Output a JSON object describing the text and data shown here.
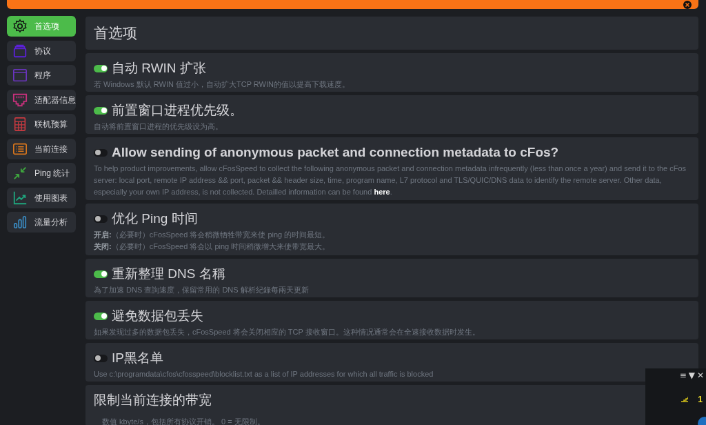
{
  "sidebar": {
    "items": [
      {
        "label": "首选项",
        "color": "#111111",
        "selected": true
      },
      {
        "label": "协议",
        "color": "#5b21d6",
        "selected": false
      },
      {
        "label": "程序",
        "color": "#6b35c0",
        "selected": false
      },
      {
        "label": "适配器信息",
        "color": "#c8307c",
        "selected": false
      },
      {
        "label": "联机预算",
        "color": "#c83a40",
        "selected": false
      },
      {
        "label": "当前连接",
        "color": "#d8761c",
        "selected": false
      },
      {
        "label": "Ping 统计",
        "color": "#3ea63e",
        "selected": false
      },
      {
        "label": "使用图表",
        "color": "#1fa67e",
        "selected": false
      },
      {
        "label": "流量分析",
        "color": "#3a8ec6",
        "selected": false
      }
    ]
  },
  "page_title": "首选项",
  "settings": [
    {
      "kind": "toggle",
      "title": "自动 RWIN 扩张",
      "on": true,
      "description": [
        "若 Windows 默认 RWIN 值过小，自动扩大TCP RWIN的值以提高下载速度。"
      ]
    },
    {
      "kind": "toggle",
      "title": "前置窗口进程优先级。",
      "on": true,
      "description": [
        "自动将前置窗口进程的优先级设为高。"
      ]
    },
    {
      "kind": "toggle",
      "title": "Allow sending of anonymous packet and connection metadata to cFos?",
      "on": false,
      "description": [
        "To help product improvements, allow cFosSpeed to collect the following anonymous packet and connection metadata infrequently (less than once a year) and send it to the cFos server: local port, remote IP address && port, packet && header size, time, program name, L7 protocol and TLS/QUIC/DNS data to identify the remote server. Other data, especially your own IP address, is not collected. Detailled information can be found"
      ],
      "link": "here",
      "after_link": "."
    },
    {
      "kind": "toggle",
      "title": "优化 Ping 时间",
      "on": false,
      "description": [
        "**开启:**（必要时）cFosSpeed 将会稍微牺牲带宽来使 ping 的时间最短。",
        "**关闭:**（必要时）cFosSpeed 将会以 ping 时间稍微增大来使带宽最大。"
      ]
    },
    {
      "kind": "toggle",
      "title": "重新整理 DNS 名稱",
      "on": true,
      "description": [
        "為了加速 DNS 查詢速度，保留常用的 DNS 解析紀錄每兩天更新"
      ]
    },
    {
      "kind": "toggle",
      "title": "避免数据包丢失",
      "on": true,
      "description": [
        "如果发现过多的数据包丢失，cFosSpeed 将会关闭相应的 TCP 接收窗口。这种情况通常会在全速接收数据时发生。"
      ]
    },
    {
      "kind": "toggle",
      "title": "IP黑名单",
      "on": false,
      "description": [
        "Use c:\\programdata\\cfos\\cfosspeed\\blocklist.txt as a list of IP addresses for which all traffic is blocked"
      ]
    },
    {
      "kind": "plain",
      "title": "限制当前连接的带宽",
      "description": [
        "数值 kbyte/s，包括所有协议开销。 0 = 无限制。"
      ]
    }
  ],
  "mini_panel": {
    "controls": [
      "≡",
      "▼",
      "✕"
    ],
    "count": "1"
  }
}
